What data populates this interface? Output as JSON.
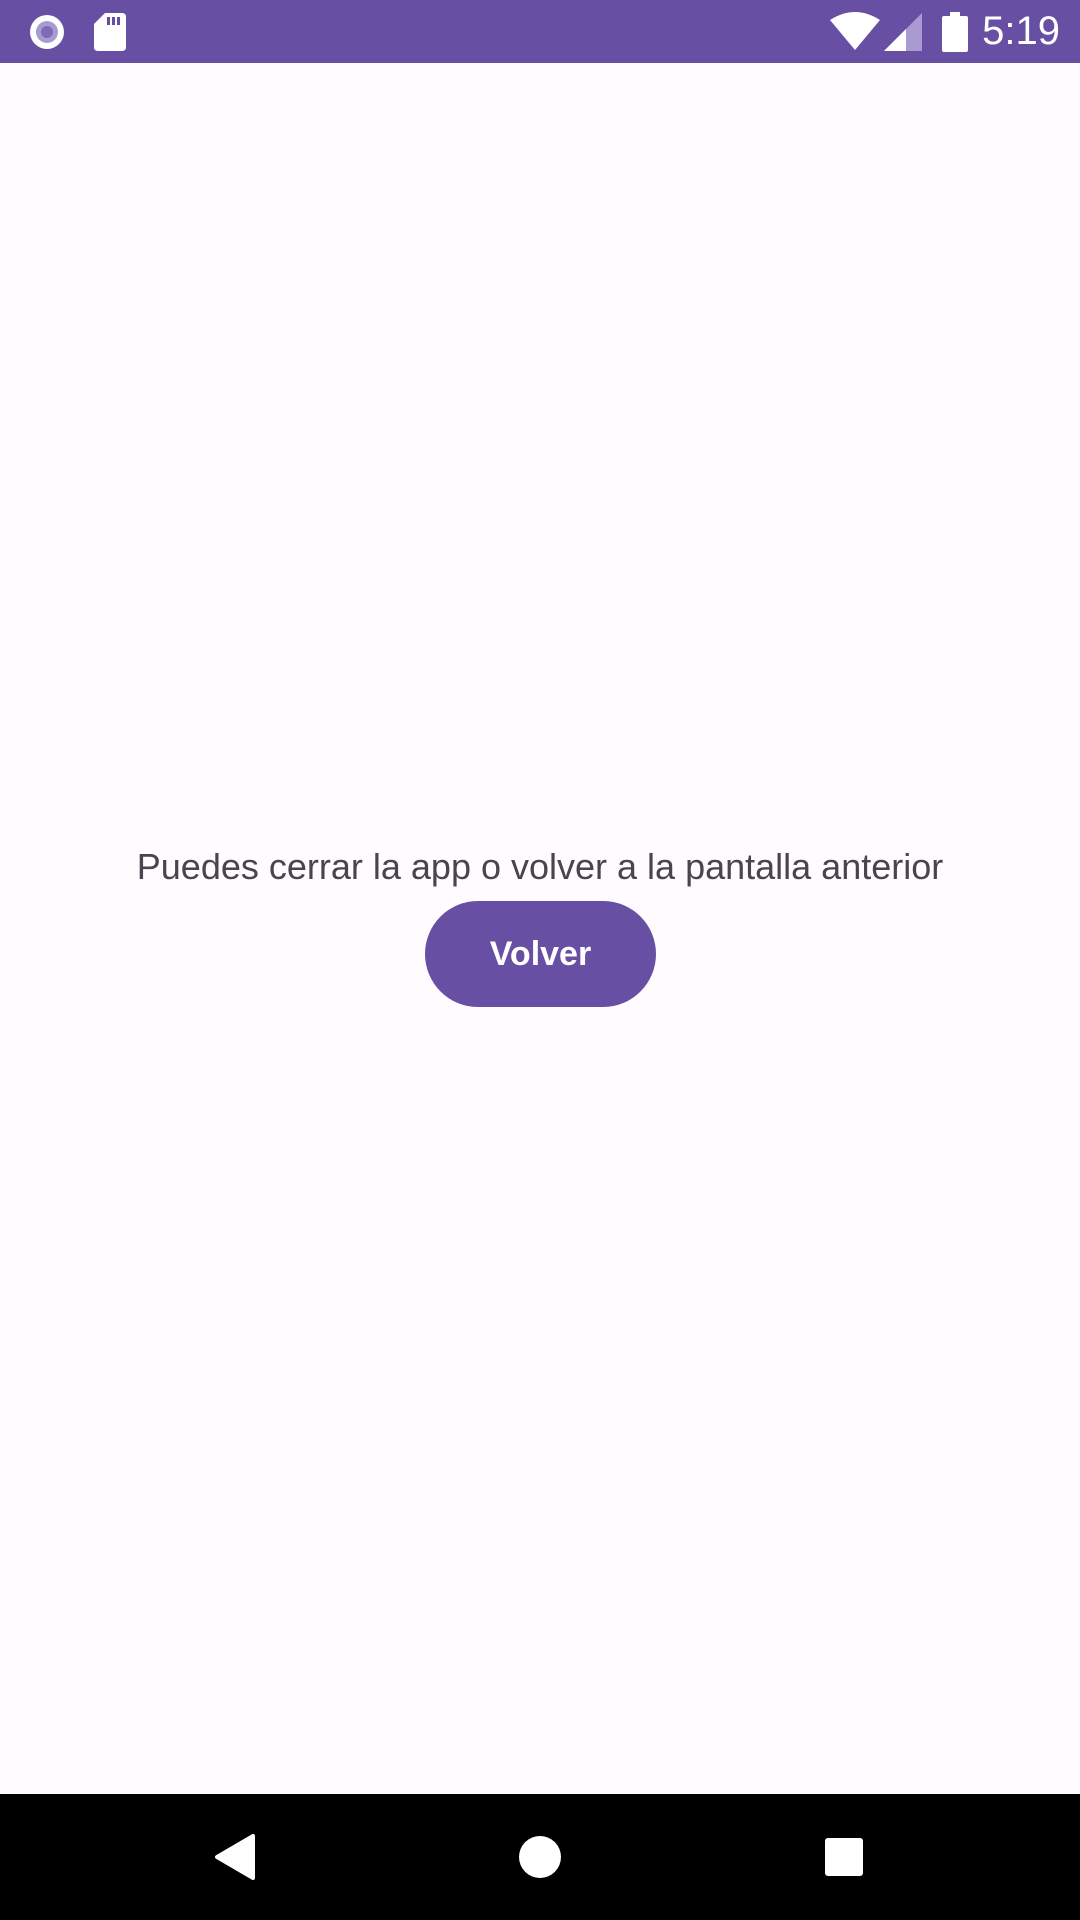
{
  "status_bar": {
    "time": "5:19",
    "background": "#6750a4",
    "icons": [
      "record-icon",
      "sd-card-icon",
      "wifi-icon",
      "cell-signal-icon",
      "battery-icon"
    ]
  },
  "main": {
    "message": "Puedes cerrar la app o volver a la pantalla anterior",
    "button_label": "Volver",
    "accent": "#6750a4",
    "background": "#fffbfe"
  },
  "nav_bar": {
    "buttons": [
      "back-icon",
      "home-icon",
      "recents-icon"
    ]
  }
}
